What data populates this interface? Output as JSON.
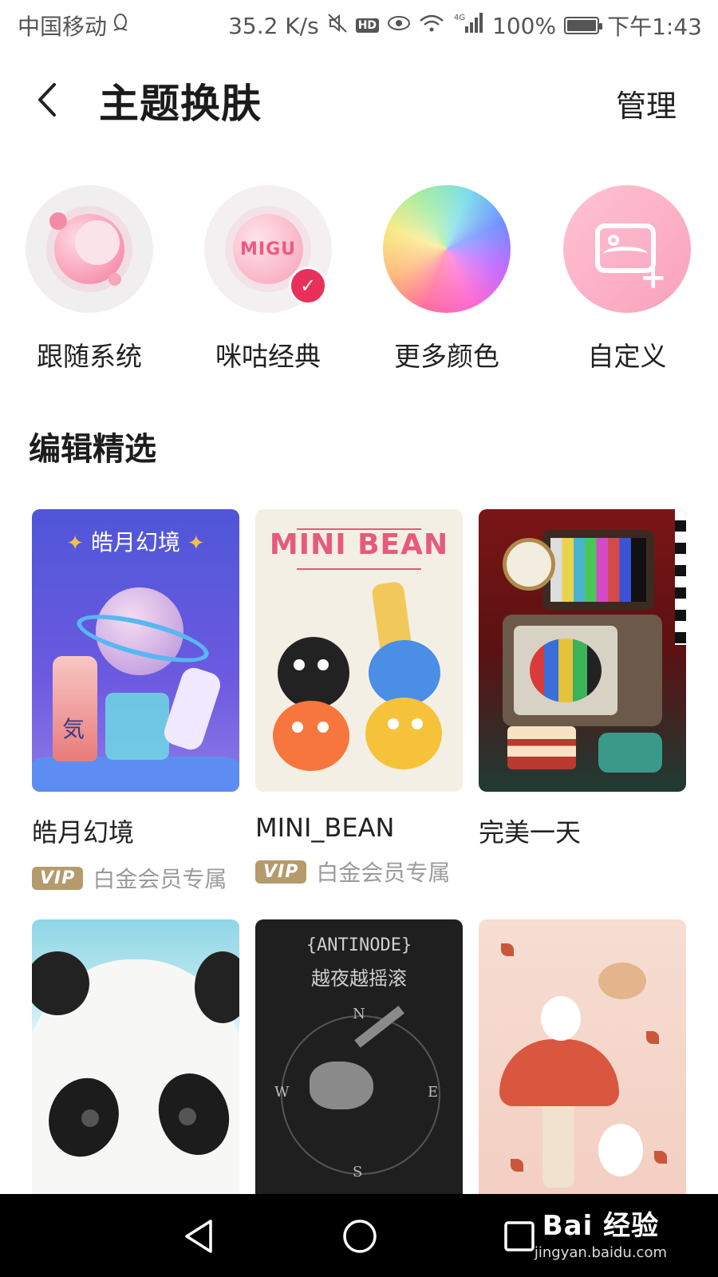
{
  "status_bar": {
    "carrier": "中国移动",
    "speed": "35.2 K/s",
    "network": "4G",
    "battery": "100%",
    "battery_level": 1.0,
    "time": "下午1:43"
  },
  "header": {
    "title": "主题换肤",
    "manage_label": "管理"
  },
  "presets": [
    {
      "label": "跟随系统",
      "icon": "moon-icon"
    },
    {
      "label": "咪咕经典",
      "icon": "migu-logo-icon",
      "badge_text": "MIGU",
      "selected": true
    },
    {
      "label": "更多颜色",
      "icon": "color-wheel-icon"
    },
    {
      "label": "自定义",
      "icon": "image-add-icon"
    }
  ],
  "section": {
    "title": "编辑精选"
  },
  "themes": [
    {
      "name": "皓月幻境",
      "thumb_title": "皓月幻境",
      "vip": true,
      "vip_badge": "VIP",
      "vip_text": "白金会员专属"
    },
    {
      "name": "MINI_BEAN",
      "thumb_title": "MINI BEAN",
      "vip": true,
      "vip_badge": "VIP",
      "vip_text": "白金会员专属"
    },
    {
      "name": "完美一天",
      "vip": false
    },
    {
      "name": "",
      "vip": false
    },
    {
      "name": "",
      "thumb_title": "{ANTINODE}",
      "thumb_subtitle": "越夜越摇滚",
      "compass": [
        "N",
        "E",
        "S",
        "W"
      ],
      "vip": false
    },
    {
      "name": "",
      "vip": false
    }
  ],
  "nav_bar": {
    "watermark_title": "Bai 经验",
    "watermark_url": "jingyan.baidu.com"
  }
}
